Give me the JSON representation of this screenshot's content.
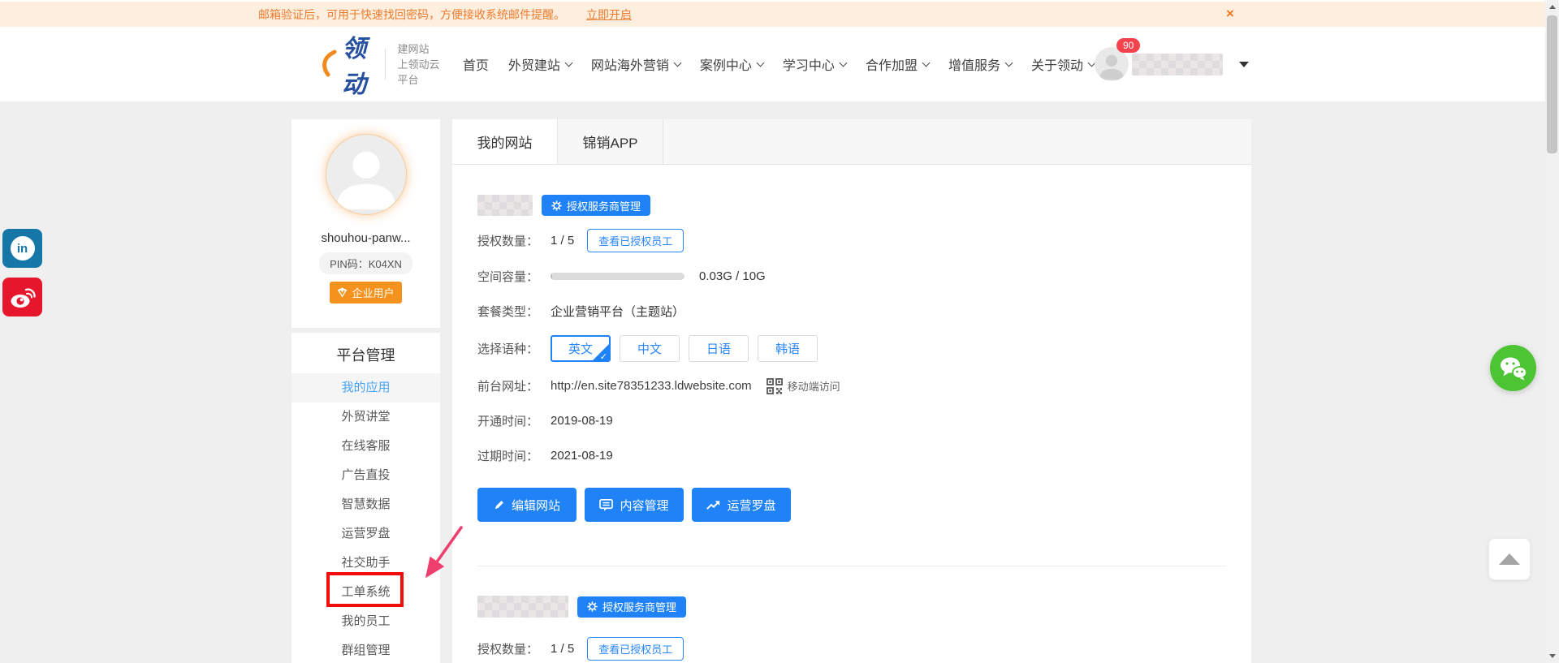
{
  "banner": {
    "message": "邮箱验证后，可用于快速找回密码，方便接收系统邮件提醒。",
    "action": "立即开启",
    "close": "×"
  },
  "header": {
    "logo_text": "领动",
    "tagline_line1": "建网站",
    "tagline_line2": "上领动云平台",
    "nav": [
      {
        "label": "首页",
        "has_dropdown": false
      },
      {
        "label": "外贸建站",
        "has_dropdown": true
      },
      {
        "label": "网站海外营销",
        "has_dropdown": true
      },
      {
        "label": "案例中心",
        "has_dropdown": true
      },
      {
        "label": "学习中心",
        "has_dropdown": true
      },
      {
        "label": "合作加盟",
        "has_dropdown": true
      },
      {
        "label": "增值服务",
        "has_dropdown": true
      },
      {
        "label": "关于领动",
        "has_dropdown": true
      }
    ],
    "user": {
      "badge_count": "90"
    }
  },
  "sidebar": {
    "profile": {
      "name": "shouhou-panw...",
      "pin": "PIN码：K04XN",
      "user_type": "企业用户"
    },
    "section_title": "平台管理",
    "menu": [
      {
        "label": "我的应用",
        "active": true
      },
      {
        "label": "外贸讲堂"
      },
      {
        "label": "在线客服"
      },
      {
        "label": "广告直投"
      },
      {
        "label": "智慧数据"
      },
      {
        "label": "运营罗盘"
      },
      {
        "label": "社交助手"
      },
      {
        "label": "工单系统",
        "annotated": true
      },
      {
        "label": "我的员工"
      },
      {
        "label": "群组管理"
      }
    ]
  },
  "main": {
    "tabs": [
      {
        "label": "我的网站",
        "active": true
      },
      {
        "label": "锦销APP",
        "active": false
      }
    ],
    "site1": {
      "auth_manage_btn": "授权服务商管理",
      "auth_count_label": "授权数量：",
      "auth_count_value": "1 / 5",
      "view_auth_btn": "查看已授权员工",
      "capacity_label": "空间容量：",
      "capacity_value": "0.03G / 10G",
      "plan_label": "套餐类型：",
      "plan_value": "企业营销平台（主题站）",
      "lang_label": "选择语种：",
      "lang_options": [
        "英文",
        "中文",
        "日语",
        "韩语"
      ],
      "lang_selected": "英文",
      "lang_check": "✓",
      "url_label": "前台网址：",
      "url_value": "http://en.site78351233.ldwebsite.com",
      "mobile_access": "移动端访问",
      "open_label": "开通时间：",
      "open_value": "2019-08-19",
      "expire_label": "过期时间：",
      "expire_value": "2021-08-19",
      "edit_btn": "编辑网站",
      "content_btn": "内容管理",
      "compass_btn": "运营罗盘"
    },
    "site2": {
      "auth_manage_btn": "授权服务商管理",
      "auth_count_label": "授权数量：",
      "auth_count_value": "1 / 5",
      "view_auth_btn": "查看已授权员工"
    }
  },
  "icons": {
    "linkedin_label": "in"
  },
  "colors": {
    "accent_blue": "#1f83f7",
    "banner_bg": "#fdeedd",
    "banner_text": "#ed7b2f",
    "badge_orange": "#f5921e",
    "annotation_red": "#f20d0d",
    "annotation_arrow_pink": "#ee3f6f",
    "linkedin_blue": "#1477a8",
    "weibo_red": "#e6162d",
    "wechat_green": "#4dc433"
  }
}
